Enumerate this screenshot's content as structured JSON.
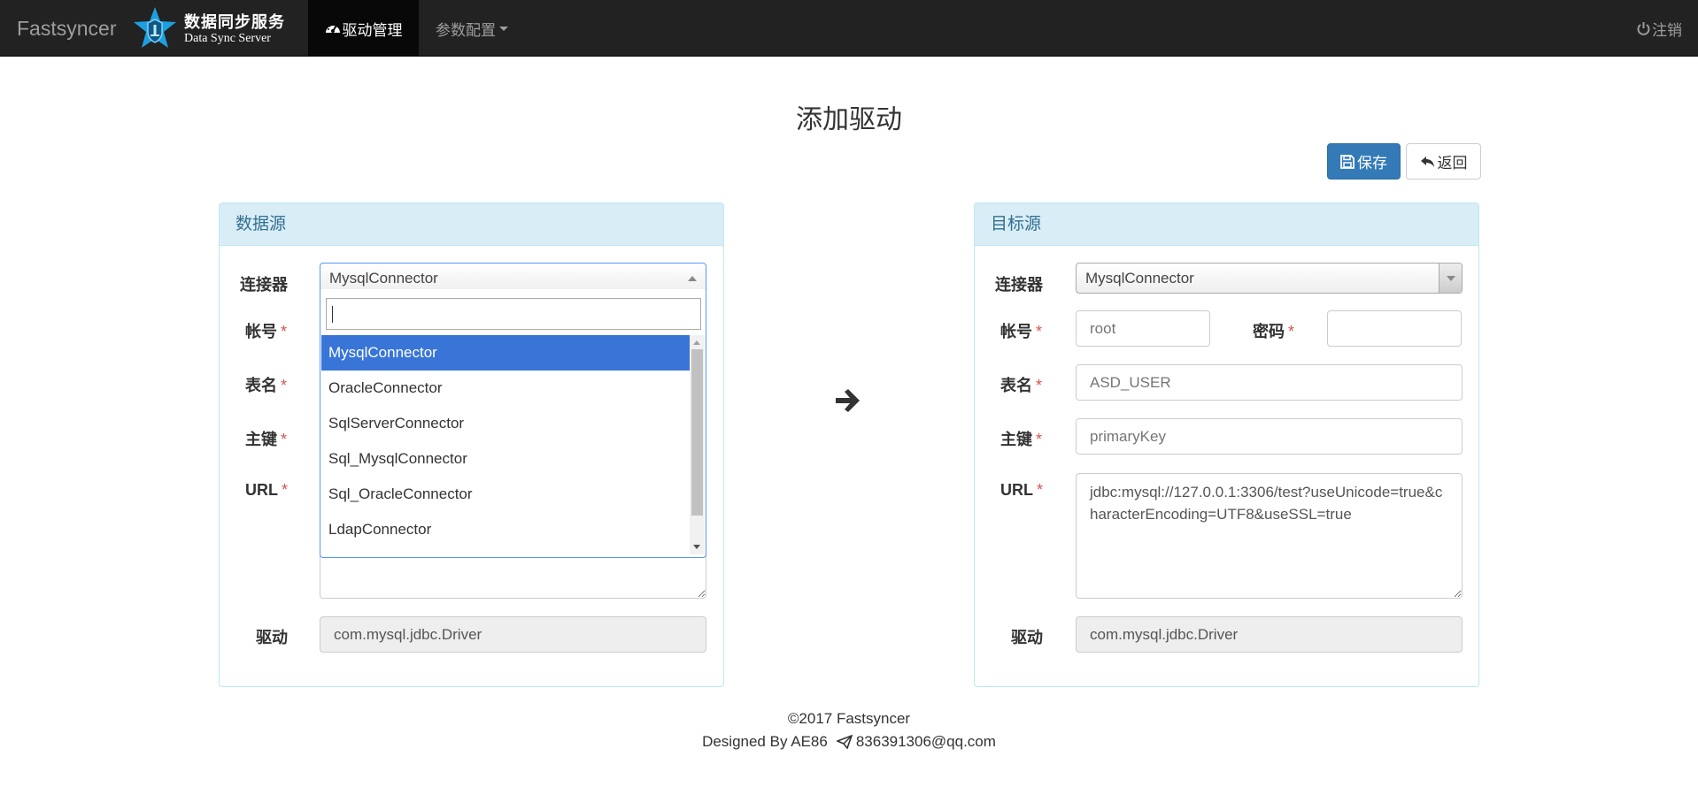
{
  "navbar": {
    "brand": "Fastsyncer",
    "logo_cn": "数据同步服务",
    "logo_en": "Data Sync Server",
    "active_item": "驱动管理",
    "params_item": "参数配置",
    "logout": "注销",
    "icons": [
      "dashboard-icon",
      "power-icon",
      "caret-down-icon"
    ]
  },
  "page": {
    "title": "添加驱动",
    "save_label": "保存",
    "back_label": "返回"
  },
  "source": {
    "heading": "数据源",
    "connector_label": "连接器",
    "connector_value": "MysqlConnector",
    "account_label": "帐号",
    "table_label": "表名",
    "pk_label": "主键",
    "url_label": "URL",
    "driver_label": "驱动",
    "driver_value": "com.mysql.jdbc.Driver",
    "required_mark": "*",
    "dropdown": {
      "search_value": "",
      "options": [
        "MysqlConnector",
        "OracleConnector",
        "SqlServerConnector",
        "Sql_MysqlConnector",
        "Sql_OracleConnector",
        "LdapConnector"
      ],
      "selected": "MysqlConnector"
    }
  },
  "target": {
    "heading": "目标源",
    "connector_label": "连接器",
    "connector_value": "MysqlConnector",
    "account_label": "帐号",
    "account_placeholder": "root",
    "password_label": "密码",
    "table_label": "表名",
    "table_placeholder": "ASD_USER",
    "pk_label": "主键",
    "pk_placeholder": "primaryKey",
    "url_label": "URL",
    "url_value": "jdbc:mysql://127.0.0.1:3306/test?useUnicode=true&characterEncoding=UTF8&useSSL=true",
    "driver_label": "驱动",
    "driver_value": "com.mysql.jdbc.Driver",
    "required_mark": "*"
  },
  "footer": {
    "copyright": "©2017 Fastsyncer",
    "designed_by": "Designed By AE86",
    "email": "836391306@qq.com"
  }
}
